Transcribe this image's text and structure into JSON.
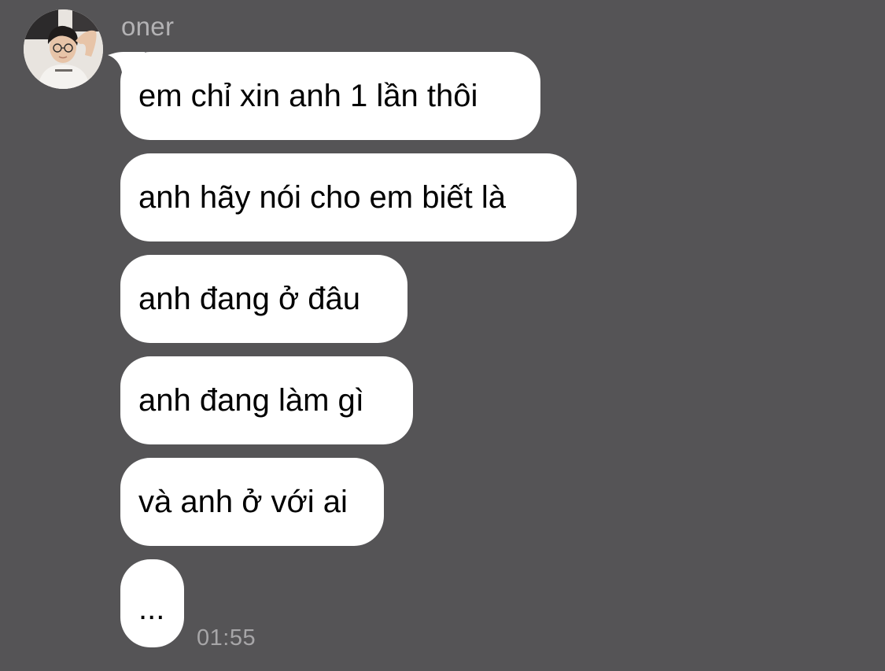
{
  "contact": {
    "name": "oner",
    "avatar_icon": "user-avatar-photo"
  },
  "messages": [
    {
      "text": "em chỉ xin anh 1 lần thôi"
    },
    {
      "text": "anh hãy nói cho em biết là"
    },
    {
      "text": "anh đang ở đâu"
    },
    {
      "text": "anh đang làm gì"
    },
    {
      "text": "và anh ở với ai"
    },
    {
      "text": "..."
    }
  ],
  "timestamp": "01:55",
  "colors": {
    "background": "#555456",
    "bubble": "#ffffff",
    "bubble_text": "#000000",
    "meta_text": "#b3b2b4"
  }
}
